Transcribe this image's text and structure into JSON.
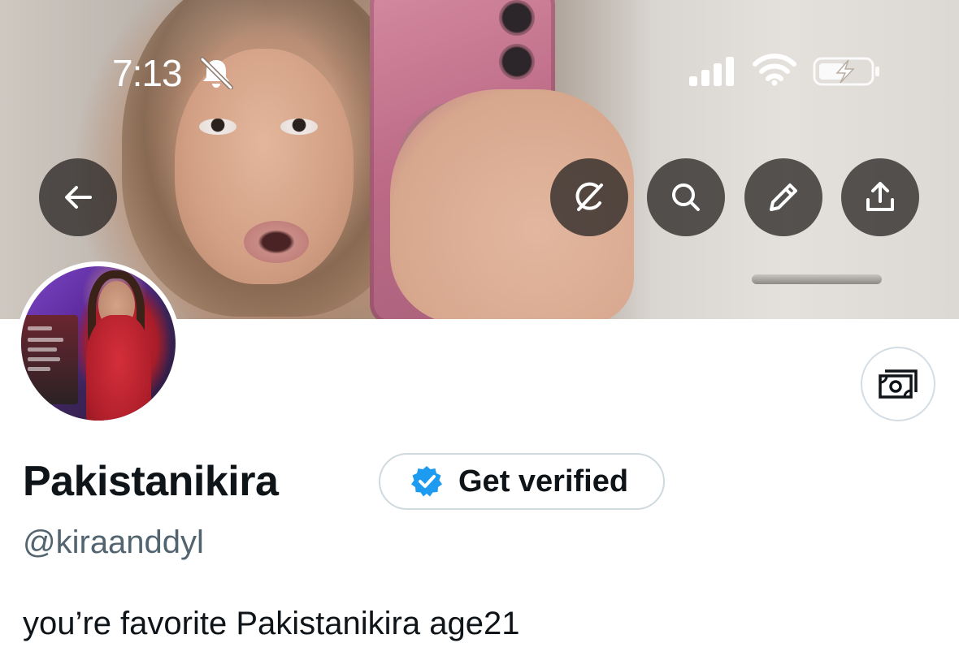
{
  "status_bar": {
    "time": "7:13",
    "silent_icon": "bell-slash-icon",
    "signal_icon": "cellular-signal-icon",
    "wifi_icon": "wifi-icon",
    "battery_icon": "battery-charging-icon"
  },
  "banner": {
    "back_icon": "arrow-left-icon",
    "actions": [
      {
        "name": "grok",
        "icon": "grok-slash-circle-icon"
      },
      {
        "name": "search",
        "icon": "search-icon"
      },
      {
        "name": "edit",
        "icon": "pencil-icon"
      },
      {
        "name": "share",
        "icon": "share-upload-icon"
      }
    ]
  },
  "profile": {
    "display_name": "Pakistanikira",
    "handle": "@kiraanddyl",
    "bio": "you’re favorite Pakistanikira age21",
    "get_verified_label": "Get verified",
    "tip_icon": "money-tip-icon"
  },
  "colors": {
    "text_primary": "#0f1419",
    "text_secondary": "#536471",
    "verified_blue": "#1d9bf0",
    "button_overlay": "#2b2826",
    "border": "#cfd9de"
  }
}
